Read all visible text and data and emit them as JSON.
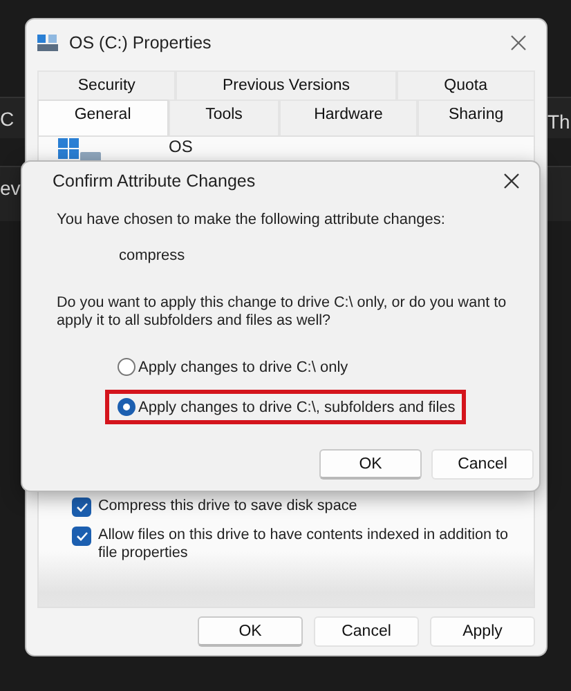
{
  "background": {
    "fragments": [
      "C",
      "ev",
      "Th"
    ]
  },
  "properties": {
    "title": "OS (C:) Properties",
    "tab_rows": [
      [
        {
          "label": "Security",
          "selected": false
        },
        {
          "label": "Previous Versions",
          "selected": false
        },
        {
          "label": "Quota",
          "selected": false
        }
      ],
      [
        {
          "label": "General",
          "selected": true
        },
        {
          "label": "Tools",
          "selected": false
        },
        {
          "label": "Hardware",
          "selected": false
        },
        {
          "label": "Sharing",
          "selected": false
        }
      ]
    ],
    "drive_label": "OS",
    "options": [
      {
        "label": "Compress this drive to save disk space",
        "checked": true
      },
      {
        "label": "Allow files on this drive to have contents indexed in addition to file properties",
        "checked": true
      }
    ],
    "buttons": [
      "OK",
      "Cancel",
      "Apply"
    ]
  },
  "dialog": {
    "title": "Confirm Attribute Changes",
    "message": "You have chosen to make the following attribute changes:",
    "attribute": "compress",
    "question": "Do you want to apply this change to drive C:\\ only, or do you want to apply it to all subfolders and files as well?",
    "choices": [
      {
        "label": "Apply changes to drive C:\\ only",
        "selected": false,
        "highlighted": false
      },
      {
        "label": "Apply changes to drive C:\\, subfolders and files",
        "selected": true,
        "highlighted": true
      }
    ],
    "buttons": [
      {
        "label": "OK",
        "default": true
      },
      {
        "label": "Cancel",
        "default": false
      }
    ]
  }
}
